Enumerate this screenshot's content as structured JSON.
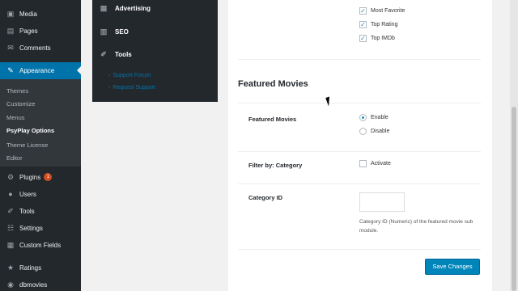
{
  "sidebar": {
    "items": [
      {
        "label": "Media",
        "icon": "media-icon"
      },
      {
        "label": "Pages",
        "icon": "pages-icon"
      },
      {
        "label": "Comments",
        "icon": "comments-icon"
      },
      {
        "label": "Appearance",
        "icon": "appearance-icon"
      },
      {
        "label": "Plugins",
        "icon": "plugins-icon",
        "badge": "1"
      },
      {
        "label": "Users",
        "icon": "users-icon"
      },
      {
        "label": "Tools",
        "icon": "tools-icon"
      },
      {
        "label": "Settings",
        "icon": "settings-icon"
      },
      {
        "label": "Custom Fields",
        "icon": "custom-fields-icon"
      },
      {
        "label": "Ratings",
        "icon": "ratings-icon"
      },
      {
        "label": "dbmovies",
        "icon": "dbmovies-icon"
      }
    ],
    "submenu": [
      "Themes",
      "Customize",
      "Menus",
      "PsyPlay Options",
      "Theme License",
      "Editor"
    ]
  },
  "options_nav": {
    "items": [
      {
        "label": "Advertising",
        "icon": "grid-icon"
      },
      {
        "label": "SEO",
        "icon": "chart-icon"
      },
      {
        "label": "Tools",
        "icon": "wrench-icon"
      }
    ],
    "links": [
      "Support Forum",
      "Request Support"
    ]
  },
  "content": {
    "checkboxes": [
      {
        "label": "Most Favorite",
        "checked": true
      },
      {
        "label": "Top Rating",
        "checked": true
      },
      {
        "label": "Top IMDb",
        "checked": true
      }
    ],
    "section_title": "Featured Movies",
    "featured_movies": {
      "label": "Featured Movies",
      "options": [
        "Enable",
        "Disable"
      ],
      "selected": "Enable"
    },
    "filter": {
      "label": "Filter by: Category",
      "checkbox_label": "Activate"
    },
    "category_id": {
      "label": "Category ID",
      "value": "",
      "description": "Category ID (Numeric) of the featured movie sub module."
    },
    "save_label": "Save Changes"
  },
  "colors": {
    "sidebar_bg": "#23282d",
    "active_bg": "#0073aa",
    "button_bg": "#0085ba",
    "badge_bg": "#d54e21"
  }
}
